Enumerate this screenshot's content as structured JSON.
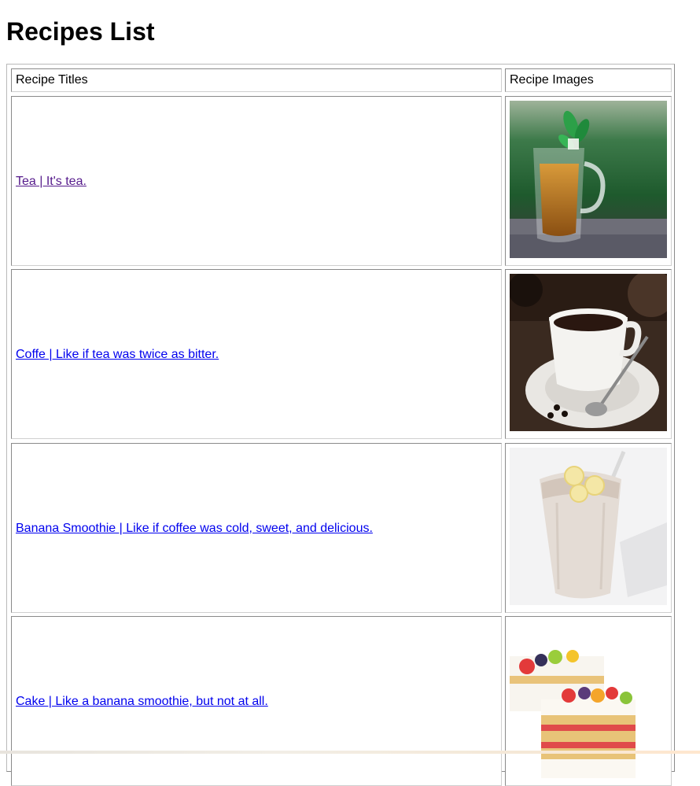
{
  "page": {
    "title": "Recipes List"
  },
  "table": {
    "headers": {
      "titles": "Recipe Titles",
      "images": "Recipe Images"
    },
    "rows": [
      {
        "title": "Tea | It's tea.",
        "image": "tea-glass-mug-photo",
        "visited": true
      },
      {
        "title": "Coffe | Like if tea was twice as bitter.",
        "image": "coffee-cup-photo",
        "visited": false
      },
      {
        "title": "Banana Smoothie | Like if coffee was cold, sweet, and delicious.",
        "image": "banana-smoothie-photo",
        "visited": false
      },
      {
        "title": "Cake | Like a banana smoothie, but not at all.",
        "image": "fruit-cake-photo",
        "visited": false
      }
    ]
  }
}
